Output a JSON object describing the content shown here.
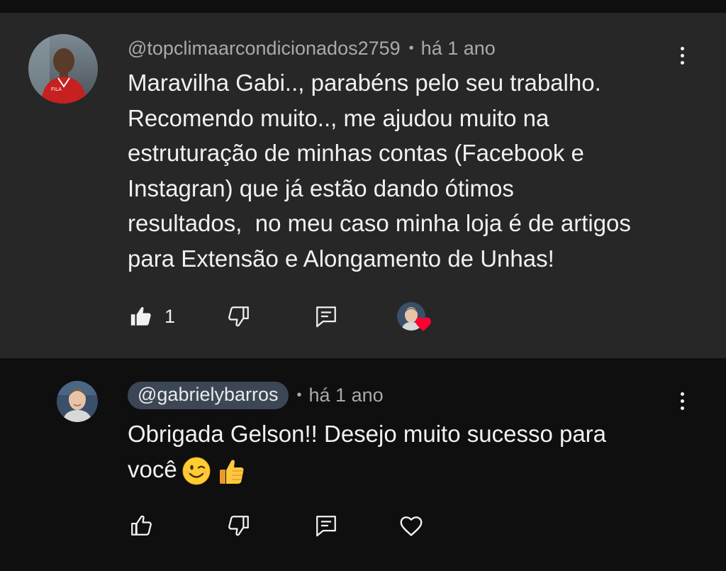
{
  "comments": [
    {
      "author": "@topclimaarcondicionados2759",
      "separator": "•",
      "time": "há 1 ano",
      "text_lines": [
        "Maravilha Gabi.., parabéns pelo seu trabalho.",
        "Recomendo muito.., me ajudou muito na",
        "estruturação de minhas contas (Facebook e",
        "Instagran) que já estão dando ótimos",
        "resultados,  no meu caso minha loja é de artigos",
        "para Extensão e Alongamento de Unhas!"
      ],
      "like_count": "1",
      "icons": {
        "like": "thumbs-up-filled-icon",
        "dislike": "thumbs-down-icon",
        "reply": "reply-comment-icon",
        "more": "more-vertical-icon",
        "hearted": "creator-heart-icon"
      }
    },
    {
      "author": "@gabrielybarros",
      "separator": "•",
      "time": "há 1 ano",
      "text_lines": [
        "Obrigada Gelson!! Desejo muito sucesso para",
        "você"
      ],
      "icons": {
        "like": "thumbs-up-outline-icon",
        "dislike": "thumbs-down-icon",
        "reply": "reply-comment-icon",
        "heart": "heart-outline-icon",
        "more": "more-vertical-icon",
        "emojis": [
          "winking-face-emoji",
          "thumbs-up-emoji"
        ]
      }
    }
  ],
  "colors": {
    "highlight_background": "#272727",
    "page_background": "#0f0f0f",
    "heart_red": "#ff0033",
    "author_chip": "#3c4654"
  }
}
